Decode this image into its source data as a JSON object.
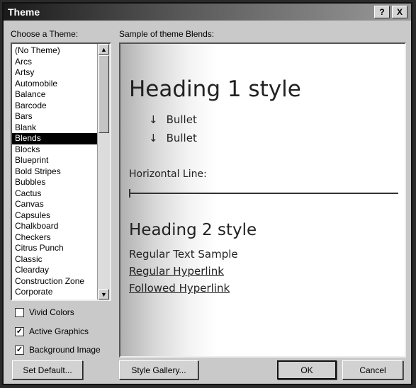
{
  "title": "Theme",
  "title_buttons": {
    "help": "?",
    "close": "X"
  },
  "choose_label": "Choose a Theme:",
  "sample_label": "Sample of theme Blends:",
  "themes": [
    "(No Theme)",
    "Arcs",
    "Artsy",
    "Automobile",
    "Balance",
    "Barcode",
    "Bars",
    "Blank",
    "Blends",
    "Blocks",
    "Blueprint",
    "Bold Stripes",
    "Bubbles",
    "Cactus",
    "Canvas",
    "Capsules",
    "Chalkboard",
    "Checkers",
    "Citrus Punch",
    "Classic",
    "Clearday",
    "Construction Zone",
    "Corporate"
  ],
  "selected_theme": "Blends",
  "options": {
    "vivid_colors": {
      "label": "Vivid Colors",
      "checked": false
    },
    "active_graphics": {
      "label": "Active Graphics",
      "checked": true
    },
    "background_image": {
      "label": "Background Image",
      "checked": true
    }
  },
  "check_mark": "✓",
  "sample": {
    "heading1": "Heading 1 style",
    "bullets": [
      "Bullet",
      "Bullet"
    ],
    "bullet_glyph": "↓",
    "hr_label": "Horizontal Line:",
    "heading2": "Heading 2 style",
    "regular_text": "Regular Text Sample",
    "regular_link": "Regular Hyperlink",
    "followed_link": "Followed Hyperlink"
  },
  "buttons": {
    "set_default": "Set Default...",
    "style_gallery": "Style Gallery...",
    "ok": "OK",
    "cancel": "Cancel"
  },
  "scroll": {
    "up": "▲",
    "down": "▼"
  }
}
